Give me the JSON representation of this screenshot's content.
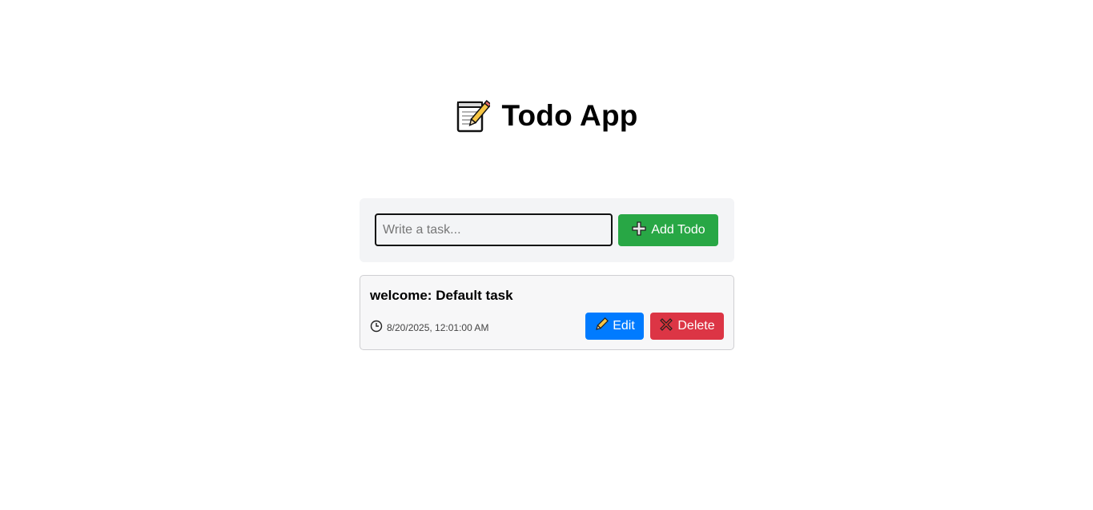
{
  "app": {
    "title": "Todo App",
    "title_icon": "memo-icon"
  },
  "form": {
    "input_placeholder": "Write a task...",
    "input_value": "",
    "add_label": "Add Todo",
    "add_icon": "plus-icon",
    "add_color": "#28a745"
  },
  "todos": [
    {
      "title": "welcome: Default task",
      "timestamp": "8/20/2025, 12:01:00 AM",
      "time_icon": "clock-icon",
      "edit_label": "Edit",
      "edit_icon": "pencil-icon",
      "edit_color": "#007bff",
      "delete_label": "Delete",
      "delete_icon": "cross-icon",
      "delete_color": "#dc3545"
    }
  ]
}
